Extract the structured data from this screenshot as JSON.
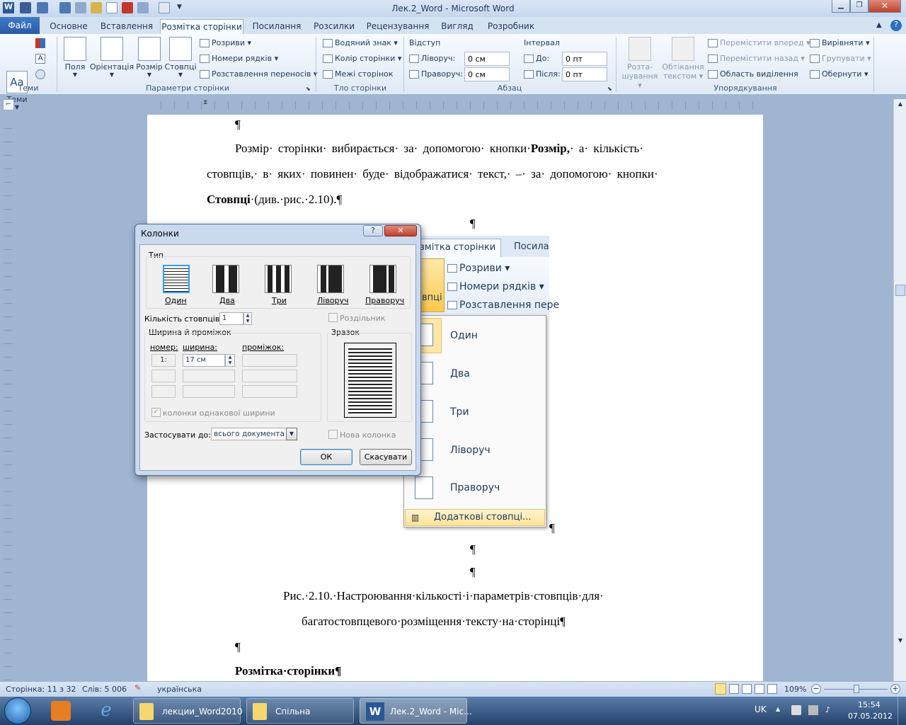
{
  "window": {
    "title": "Лек.2_Word - Microsoft Word"
  },
  "tabs": [
    "Файл",
    "Основне",
    "Вставлення",
    "Розмітка сторінки",
    "Посилання",
    "Розсилки",
    "Рецензування",
    "Вигляд",
    "Розробник"
  ],
  "ribbon": {
    "themes": {
      "label": "Теми",
      "group": "Теми"
    },
    "page_setup": {
      "group": "Параметри сторінки",
      "fields": "Поля",
      "orientation": "Орієнтація",
      "size": "Розмір",
      "columns": "Стовпці",
      "breaks": "Розриви",
      "line_numbers": "Номери рядків",
      "hyphenation": "Розставлення переносів"
    },
    "background": {
      "group": "Тло сторінки",
      "watermark": "Водяний знак",
      "page_color": "Колір сторінки",
      "borders": "Межі сторінок"
    },
    "paragraph": {
      "group": "Абзац",
      "indent": "Відступ",
      "left": "Ліворуч:",
      "right": "Праворуч:",
      "left_val": "0 см",
      "right_val": "0 см",
      "spacing": "Інтервал",
      "before": "До:",
      "after": "Після:",
      "before_val": "0 пт",
      "after_val": "0 пт"
    },
    "arrange": {
      "group": "Упорядкування",
      "position1": "Розта-",
      "position2": "шування",
      "wrap1": "Обтікання",
      "wrap2": "текстом",
      "bring_forward": "Перемістити вперед",
      "send_backward": "Перемістити назад",
      "selection_pane": "Область виділення",
      "align": "Вирівняти",
      "group_btn": "Групувати",
      "rotate": "Обернути"
    }
  },
  "document": {
    "pilcrow": "¶",
    "p1_l1": "Розмір· сторінки· вибирається· за· допомогою· кнопки·",
    "p1_b1": "Розмір,",
    "p1_l1b": "· а· кількість·",
    "p1_l2": "стовпців,· в· яких· повинен· буде· відображатися· текст,· –· за· допомогою· кнопки·",
    "p1_b2": "Стовпці",
    "p1_l3": "·(див.·рис.·2.10).¶",
    "caption1": "Рис.·2.10.·Настроювання·кількості·і·параметрів·стовпців·для·",
    "caption2": "багатостовпцевого·розміщення·тексту·на·сторінці¶",
    "heading": "Розмітка·сторінки¶"
  },
  "menu_image": {
    "tab1": "змітка сторінки",
    "tab2": "Посила",
    "breaks": "Розриви",
    "line_numbers": "Номери рядків",
    "hyphenation": "Розставлення пере",
    "columns_label": "впці",
    "items": [
      "Один",
      "Два",
      "Три",
      "Ліворуч",
      "Праворуч"
    ],
    "more": "Додаткові стовпці..."
  },
  "dialog": {
    "title": "Колонки",
    "type_label": "Тип",
    "presets": [
      "Один",
      "Два",
      "Три",
      "Ліворуч",
      "Праворуч"
    ],
    "count_label": "Кількість стовпців:",
    "count_value": "1",
    "separator": "Роздільник",
    "width_spacing": "Ширина й проміжок",
    "preview": "Зразок",
    "col_number": "номер:",
    "col_width": "ширина:",
    "col_spacing": "проміжок:",
    "row1_num": "1:",
    "row1_width": "17 см",
    "equal_width": "колонки однакової ширини",
    "apply_label": "Застосувати до:",
    "apply_value": "всього документа",
    "new_column": "Нова колонка",
    "ok": "ОК",
    "cancel": "Скасувати"
  },
  "status": {
    "page": "Сторінка: 11 з 32",
    "words": "Слів: 5 006",
    "language": "українська",
    "zoom": "109%"
  },
  "taskbar": {
    "items": [
      "лекции_Word2010",
      "Спільна",
      "Лек.2_Word - Mic..."
    ],
    "lang": "UK",
    "time": "15:54",
    "date": "07.05.2012"
  }
}
